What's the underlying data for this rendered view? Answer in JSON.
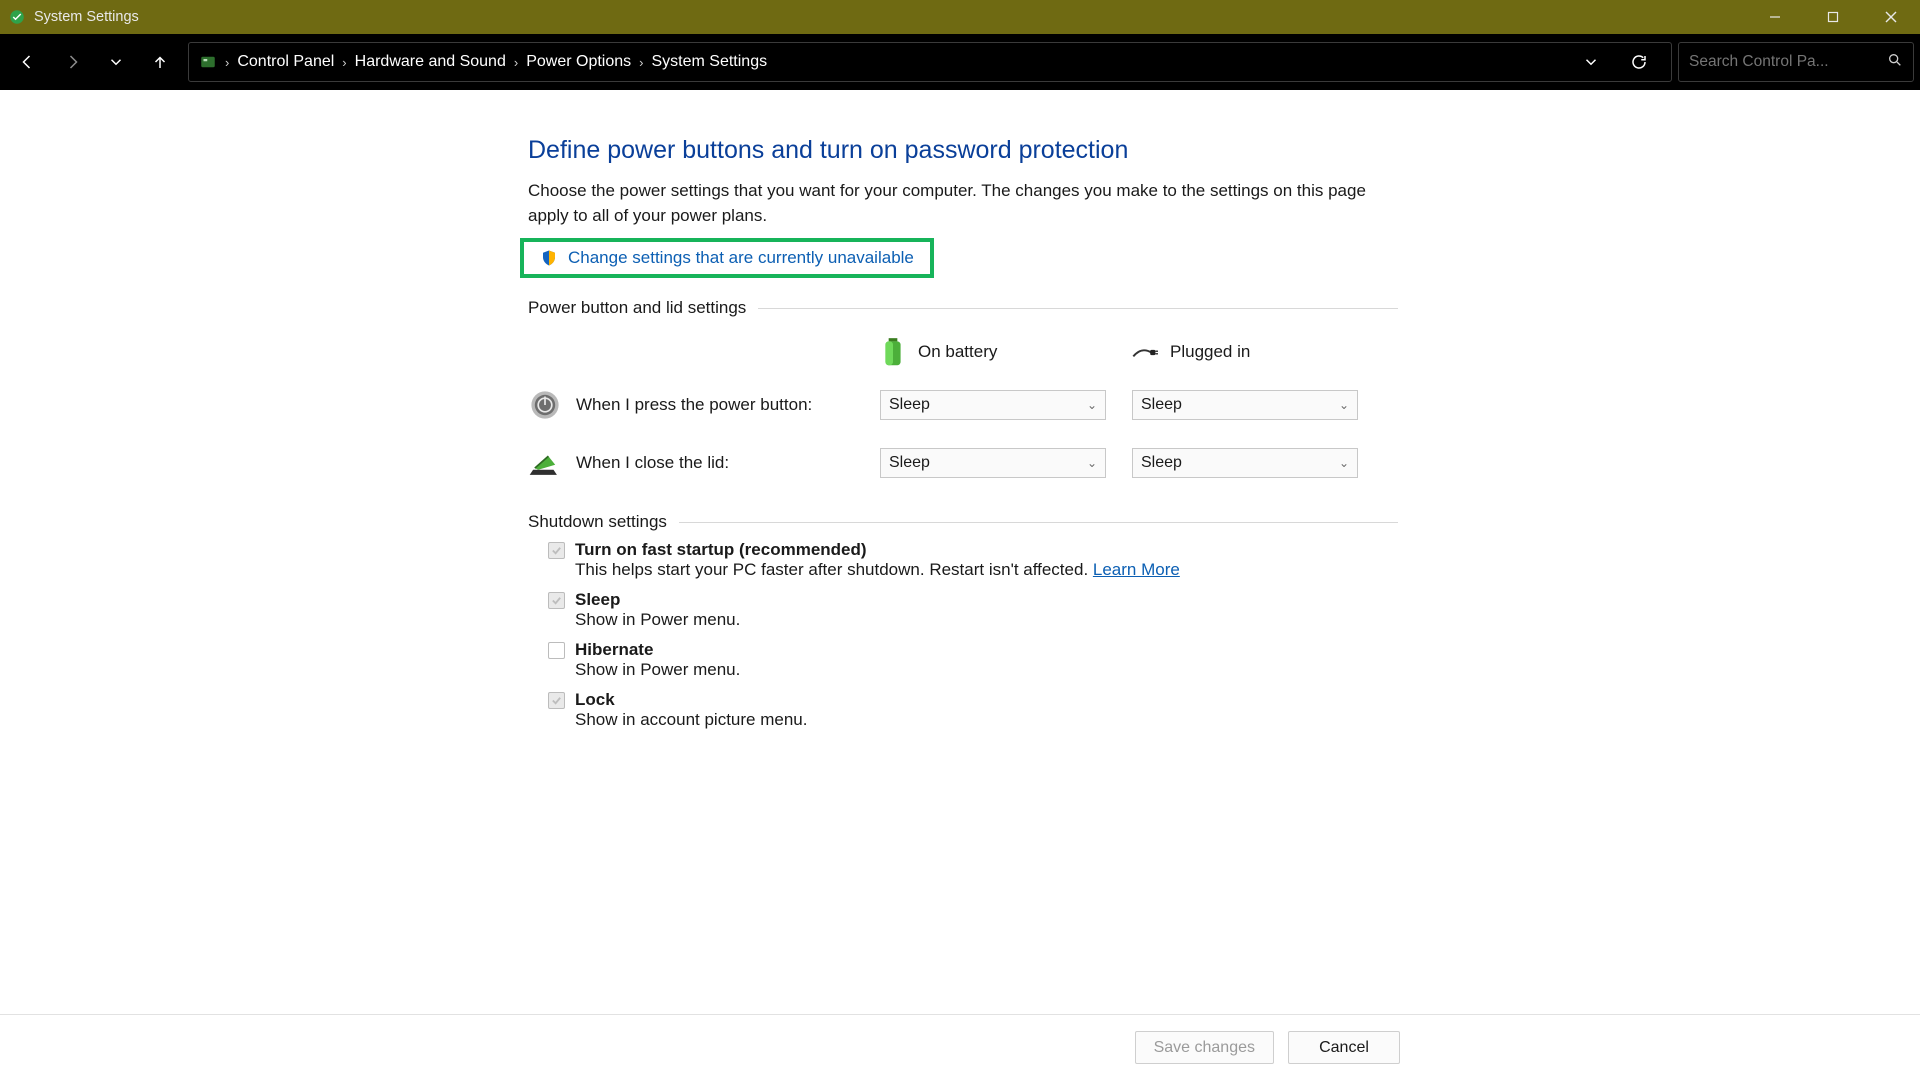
{
  "window": {
    "title": "System Settings"
  },
  "breadcrumbs": [
    "Control Panel",
    "Hardware and Sound",
    "Power Options",
    "System Settings"
  ],
  "search": {
    "placeholder": "Search Control Pa..."
  },
  "page": {
    "heading": "Define power buttons and turn on password protection",
    "intro": "Choose the power settings that you want for your computer. The changes you make to the settings on this page apply to all of your power plans.",
    "admin_link": "Change settings that are currently unavailable"
  },
  "group1": {
    "title": "Power button and lid settings",
    "col_battery": "On battery",
    "col_plugged": "Plugged in",
    "rows": [
      {
        "label": "When I press the power button:",
        "battery": "Sleep",
        "plugged": "Sleep"
      },
      {
        "label": "When I close the lid:",
        "battery": "Sleep",
        "plugged": "Sleep"
      }
    ]
  },
  "group2": {
    "title": "Shutdown settings",
    "items": [
      {
        "title": "Turn on fast startup (recommended)",
        "bold": true,
        "checked": true,
        "desc": "This helps start your PC faster after shutdown. Restart isn't affected. ",
        "learn": "Learn More"
      },
      {
        "title": "Sleep",
        "bold": true,
        "checked": true,
        "desc": "Show in Power menu."
      },
      {
        "title": "Hibernate",
        "bold": true,
        "checked": false,
        "desc": "Show in Power menu."
      },
      {
        "title": "Lock",
        "bold": true,
        "checked": true,
        "desc": "Show in account picture menu."
      }
    ]
  },
  "footer": {
    "save": "Save changes",
    "cancel": "Cancel"
  }
}
